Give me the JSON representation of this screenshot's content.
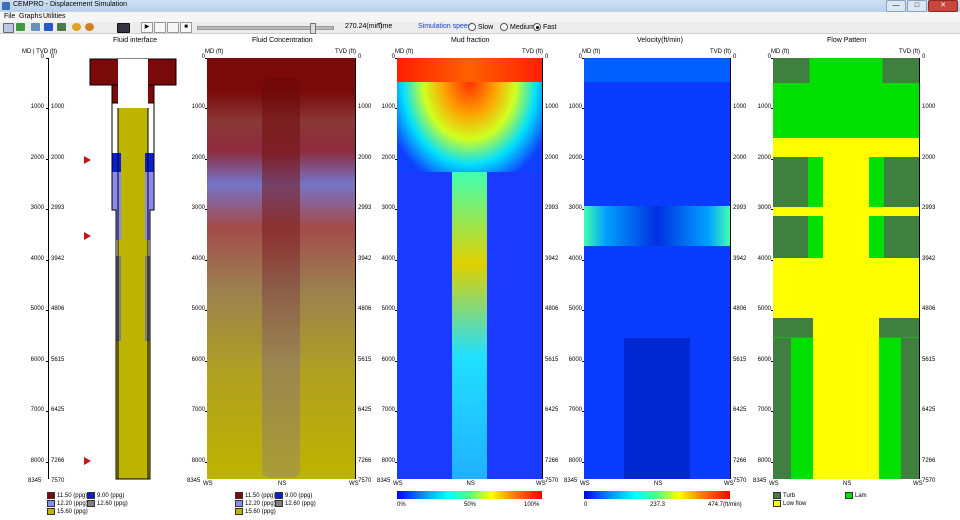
{
  "window": {
    "title": "CEMPRO - Displacement Simulation",
    "minimize": "—",
    "maximize": "□",
    "close": "✕"
  },
  "menu": [
    "File",
    "Graphs",
    "Utilities"
  ],
  "toolbar": {
    "time_value": "270.24(min)",
    "time_label": "Time",
    "speed_label": "Simulation speed",
    "slider_position": 0.86,
    "speed_options": [
      {
        "label": "Slow",
        "selected": false
      },
      {
        "label": "Medium",
        "selected": false
      },
      {
        "label": "Fast",
        "selected": true
      }
    ],
    "play_icon": "▶",
    "stop_icon": "■"
  },
  "panels": {
    "fluid_interface": {
      "title": "Fluid interface",
      "md_label": "MD",
      "tvd_label": "TVD (ft)"
    },
    "fluid_concentration": {
      "title": "Fluid Concentration"
    },
    "mud_fraction": {
      "title": "Mud fraction"
    },
    "velocity": {
      "title": "Velocity(ft/min)"
    },
    "flow_pattern": {
      "title": "Flow Pattern"
    }
  },
  "axis": {
    "md_header": "MD (ft)",
    "tvd_header": "TVD (ft)",
    "md_ticks": [
      "0",
      "1000",
      "2000",
      "3000",
      "4000",
      "5000",
      "6000",
      "7000",
      "8000"
    ],
    "md_bottom": "8345",
    "tvd_ticks": [
      "0",
      "1000",
      "2000",
      "2993",
      "3942",
      "4806",
      "5615",
      "6425",
      "7266"
    ],
    "tvd_bottom": "7570",
    "x_ticks": [
      "WS",
      "NS",
      "WS"
    ]
  },
  "legends": {
    "fluids": [
      {
        "label": "11.50 (ppg)",
        "color": "#7a0a0a"
      },
      {
        "label": "9.00 (ppg)",
        "color": "#0a1ed2"
      },
      {
        "label": "12.20 (ppg)",
        "color": "#8c8cf0"
      },
      {
        "label": "12.60 (ppg)",
        "color": "#808080"
      },
      {
        "label": "15.60 (ppg)",
        "color": "#bdb400"
      }
    ],
    "mud_scale": [
      "0%",
      "50%",
      "100%"
    ],
    "velocity_scale": [
      "0",
      "237.3",
      "474.7(ft/min)"
    ],
    "flow": [
      {
        "label": "Turb",
        "color": "#3f7f3f"
      },
      {
        "label": "Lam",
        "color": "#00e000"
      },
      {
        "label": "Low flow",
        "color": "#ffff00"
      }
    ]
  },
  "colors": {
    "mud": "#7a0a0a",
    "spacer": "#0a1ed2",
    "lead": "#8c8cf0",
    "mid": "#808080",
    "tail": "#bdb400",
    "turb": "#3f7f3f",
    "lam": "#00e000",
    "low": "#ffff00",
    "marker": "#c01818"
  }
}
